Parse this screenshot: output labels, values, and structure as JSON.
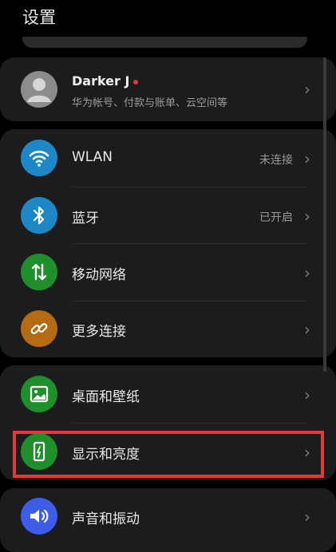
{
  "page_title": "设置",
  "account": {
    "name": "Darker J",
    "subtitle": "华为帐号、付款与账单、云空间等"
  },
  "connectivity": [
    {
      "label": "WLAN",
      "value": "未连接",
      "icon": "wifi-icon",
      "color": "#1e88c7"
    },
    {
      "label": "蓝牙",
      "value": "已开启",
      "icon": "bluetooth-icon",
      "color": "#1e88c7"
    },
    {
      "label": "移动网络",
      "value": "",
      "icon": "mobile-data-icon",
      "color": "#1f8f2b"
    },
    {
      "label": "更多连接",
      "value": "",
      "icon": "link-icon",
      "color": "#b56b11"
    }
  ],
  "display": [
    {
      "label": "桌面和壁纸",
      "icon": "wallpaper-icon",
      "color": "#1f8f2b"
    },
    {
      "label": "显示和亮度",
      "icon": "brightness-icon",
      "color": "#1f8f2b"
    }
  ],
  "sound": [
    {
      "label": "声音和振动",
      "icon": "speaker-icon",
      "color": "#3d5ce8"
    }
  ],
  "highlight_color": "#e03a3a"
}
